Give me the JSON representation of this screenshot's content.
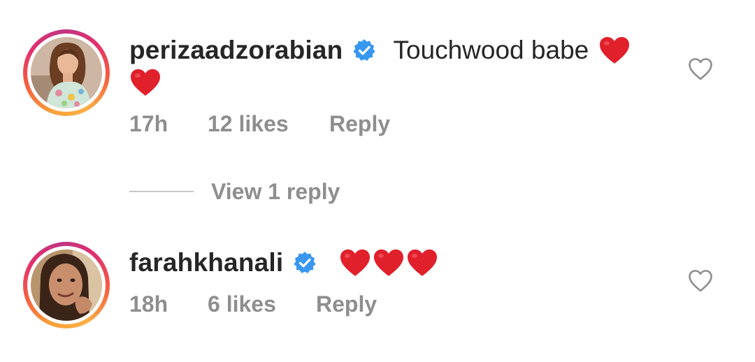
{
  "comments": [
    {
      "username": "perizaadzorabian",
      "verified": true,
      "text": "Touchwood babe",
      "hearts_inline": 1,
      "hearts_continued": 1,
      "time": "17h",
      "likes": "12 likes",
      "reply_label": "Reply",
      "avatar_icon": "profile-photo-woman-floral-top"
    },
    {
      "username": "farahkhanali",
      "verified": true,
      "text": "",
      "hearts_inline": 3,
      "time": "18h",
      "likes": "6 likes",
      "reply_label": "Reply",
      "avatar_icon": "profile-photo-woman-smiling"
    }
  ],
  "view_replies": {
    "label": "View 1 reply"
  },
  "colors": {
    "text_primary": "#262626",
    "text_secondary": "#8e8e8e",
    "verified_blue": "#3897f0",
    "heart_red": "#e0202b",
    "divider": "#c7c7c7"
  }
}
